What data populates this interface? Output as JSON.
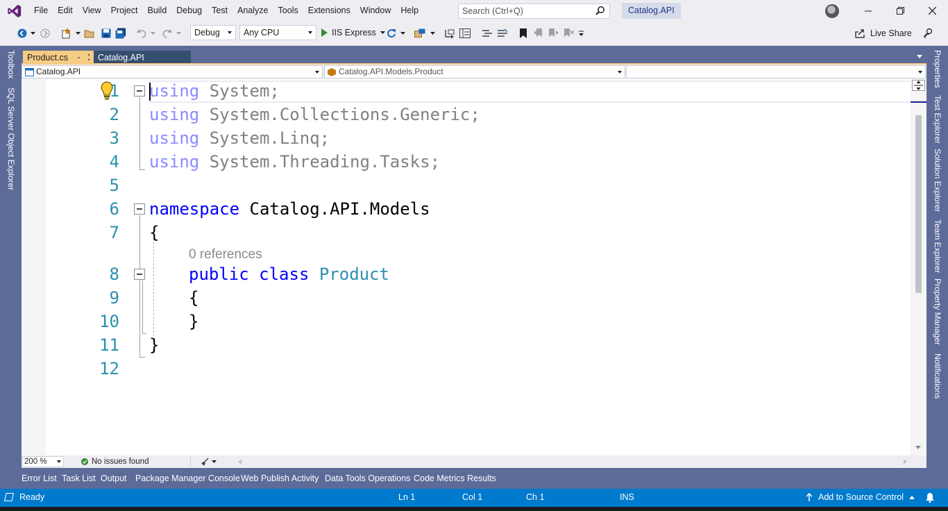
{
  "menu": {
    "items": [
      "File",
      "Edit",
      "View",
      "Project",
      "Build",
      "Debug",
      "Test",
      "Analyze",
      "Tools",
      "Extensions",
      "Window",
      "Help"
    ],
    "search_placeholder": "Search (Ctrl+Q)",
    "solution_name": "Catalog.API"
  },
  "toolbar": {
    "configuration": "Debug",
    "platform": "Any CPU",
    "run_target": "IIS Express",
    "live_share": "Live Share"
  },
  "left_tool_tabs": [
    "Toolbox",
    "SQL Server Object Explorer"
  ],
  "right_tool_tabs": [
    "Properties",
    "Test Explorer",
    "Solution Explorer",
    "Team Explorer",
    "Property Manager",
    "Notifications"
  ],
  "doc_tabs": {
    "active": "Product.cs",
    "other": "Catalog.API"
  },
  "navbar": {
    "project": "Catalog.API",
    "type": "Catalog.API.Models.Product",
    "member": ""
  },
  "editor": {
    "line_numbers": [
      "1",
      "2",
      "3",
      "4",
      "5",
      "6",
      "7",
      "8",
      "9",
      "10",
      "11",
      "12"
    ],
    "codelens": "0 references",
    "lines": {
      "l1_kw": "using",
      "l1_rest": " System;",
      "l2_kw": "using",
      "l2_rest": " System.Collections.Generic;",
      "l3_kw": "using",
      "l3_rest": " System.Linq;",
      "l4_kw": "using",
      "l4_rest": " System.Threading.Tasks;",
      "l6_kw": "namespace",
      "l6_rest": " Catalog.API.Models",
      "l7": "{",
      "l8_kw1": "public",
      "l8_kw2": "class",
      "l8_type": "Product",
      "l9": "{",
      "l10": "}",
      "l11": "}"
    }
  },
  "editor_status": {
    "zoom": "200 %",
    "issues": "No issues found"
  },
  "bottom_tabs": [
    "Error List",
    "Task List",
    "Output",
    "Package Manager Console",
    "Web Publish Activity",
    "Data Tools Operations",
    "Code Metrics Results"
  ],
  "status": {
    "ready": "Ready",
    "line": "Ln 1",
    "col": "Col 1",
    "ch": "Ch 1",
    "mode": "INS",
    "source_control": "Add to Source Control"
  },
  "colors": {
    "accent": "#007acc",
    "chrome": "#eeeef2",
    "frame": "#5d6b99",
    "active_tab": "#f5cc84",
    "keyword": "#0000ff",
    "type": "#2b91af",
    "line_number": "#2b91af"
  }
}
